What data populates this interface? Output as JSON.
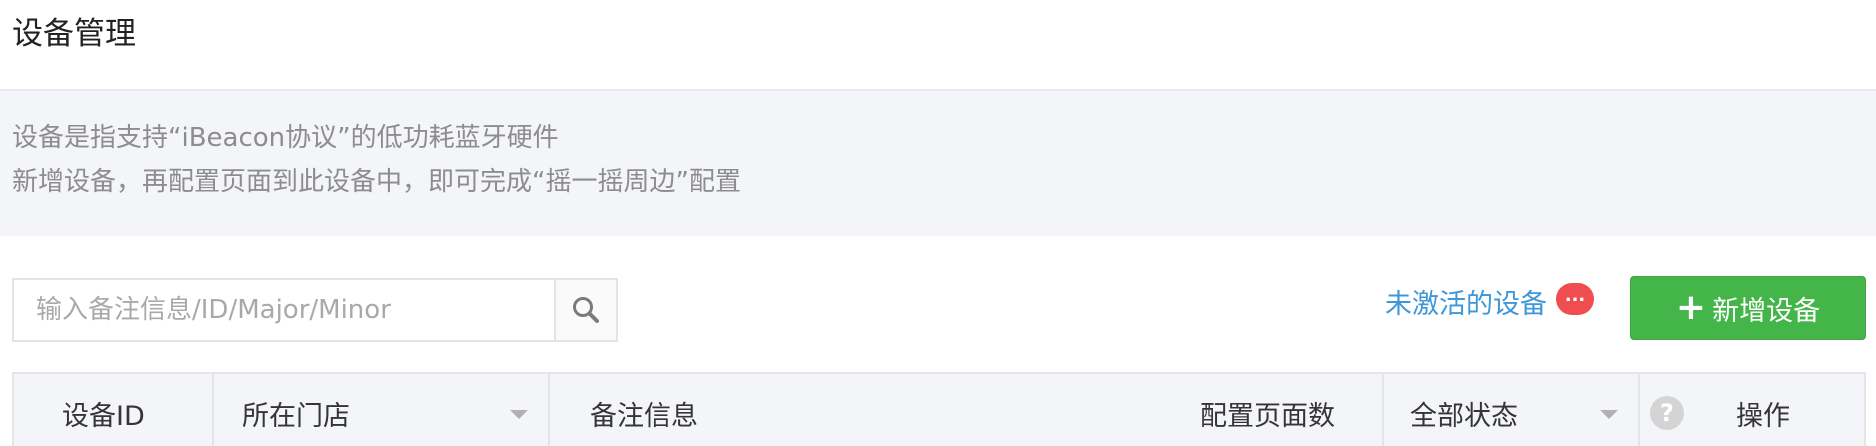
{
  "header": {
    "title": "设备管理"
  },
  "info": {
    "line1": "设备是指支持“iBeacon协议”的低功耗蓝牙硬件",
    "line2": "新增设备，再配置页面到此设备中，即可完成“摇一摇周边”配置"
  },
  "search": {
    "placeholder": "输入备注信息/ID/Major/Minor",
    "value": "",
    "icon": "search-icon"
  },
  "toolbar": {
    "inactive_link": "未激活的设备",
    "badge": "...",
    "add_icon": "plus-icon",
    "add_label": "新增设备",
    "accent_color": "#44b549",
    "link_color": "#3e97d8",
    "badge_color": "#ef4d4f"
  },
  "table": {
    "columns": [
      {
        "label": "设备ID"
      },
      {
        "label": "所在门店",
        "dropdown": true
      },
      {
        "label": "备注信息"
      },
      {
        "label": "配置页面数"
      },
      {
        "label": "全部状态",
        "dropdown": true
      },
      {
        "label": "操作",
        "help_icon": "question-icon",
        "help_glyph": "?"
      }
    ]
  }
}
